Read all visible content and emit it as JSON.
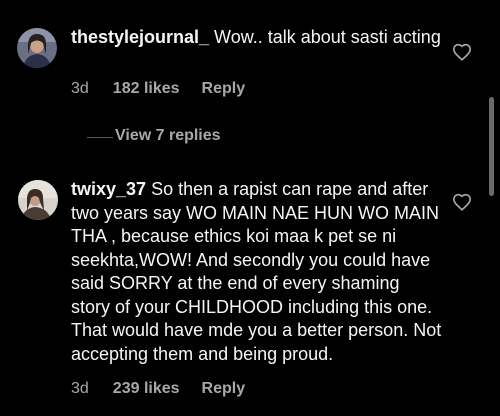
{
  "comments": [
    {
      "username": "thestylejournal_",
      "text": " Wow.. talk about sasti acting",
      "time": "3d",
      "likes": "182 likes",
      "reply": "Reply",
      "avatar_icon": "profile-photo",
      "like_icon": "heart-outline-icon"
    },
    {
      "username": "twixy_37",
      "text": " So then a rapist can rape and after two years say WO MAIN NAE HUN WO MAIN THA , because ethics koi maa k pet se ni seekhta,WOW! And secondly you could have said SORRY at the end of every shaming story of your CHILDHOOD including this one. That would have mde you a better person. Not accepting them and being proud.",
      "time": "3d",
      "likes": "239 likes",
      "reply": "Reply",
      "avatar_icon": "profile-photo",
      "like_icon": "heart-outline-icon"
    }
  ],
  "view_replies": "View 7 replies",
  "colors": {
    "background": "#000000",
    "text": "#f5f5f5",
    "secondary": "#a8a8a8"
  }
}
